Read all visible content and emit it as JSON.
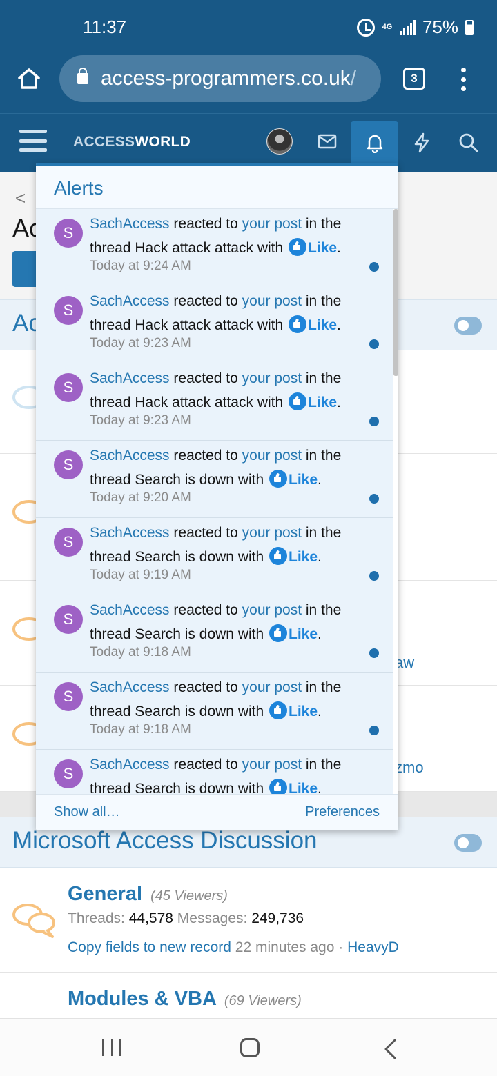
{
  "status": {
    "time": "11:37",
    "network": "4G",
    "battery": "75%"
  },
  "browser": {
    "url": "access-programmers.co.uk",
    "url_trailing": "/",
    "tab_count": "3"
  },
  "site": {
    "logo_part1": "ACCESS",
    "logo_part2": "WORLD"
  },
  "page": {
    "section_main": "Microsoft Access Discussion",
    "forums": [
      {
        "title": "General",
        "viewers": "(45 Viewers)",
        "threads_label": "Threads:",
        "threads": "44,578",
        "messages_label": "Messages:",
        "messages": "249,736",
        "last_thread": "Copy fields to new record",
        "last_time": "22 minutes ago",
        "separator": "·",
        "last_user": "HeavyD"
      },
      {
        "title": "Modules & VBA",
        "viewers": "(69 Viewers)"
      }
    ]
  },
  "alerts": {
    "title": "Alerts",
    "reacted_to": "reacted to",
    "your_post": "your post",
    "in_the": "in the",
    "thread_word": "thread",
    "with_word": "with",
    "like_label": "Like",
    "period": ".",
    "items": [
      {
        "initial": "S",
        "user": "SachAccess",
        "thread": "Hack attack attack",
        "time": "Today at 9:24 AM"
      },
      {
        "initial": "S",
        "user": "SachAccess",
        "thread": "Hack attack attack",
        "time": "Today at 9:23 AM"
      },
      {
        "initial": "S",
        "user": "SachAccess",
        "thread": "Hack attack attack",
        "time": "Today at 9:23 AM"
      },
      {
        "initial": "S",
        "user": "SachAccess",
        "thread": "Search is down",
        "time": "Today at 9:20 AM"
      },
      {
        "initial": "S",
        "user": "SachAccess",
        "thread": "Search is down",
        "time": "Today at 9:19 AM"
      },
      {
        "initial": "S",
        "user": "SachAccess",
        "thread": "Search is down",
        "time": "Today at 9:18 AM"
      },
      {
        "initial": "S",
        "user": "SachAccess",
        "thread": "Search is down",
        "time": "Today at 9:18 AM"
      },
      {
        "initial": "S",
        "user": "SachAccess",
        "thread": "Search is down",
        "time": ""
      }
    ],
    "show_all": "Show all…",
    "preferences": "Preferences"
  },
  "peek": {
    "title_fragment": "Ac",
    "section_fragment": "Ac",
    "row_fragment_1": "aw",
    "row_fragment_2": "zmo",
    "back_glyph": "<"
  },
  "colors": {
    "header": "#185886",
    "accent": "#2577b1",
    "unread": "#1f6fad",
    "avatar": "#9e61c5",
    "like": "#1d84da"
  },
  "icons": [
    "home-icon",
    "lock-icon",
    "kebab-icon",
    "hamburger-icon",
    "mail-icon",
    "bell-icon",
    "bolt-icon",
    "search-icon",
    "like-icon",
    "chat-bubble-icon",
    "toggle-icon"
  ]
}
